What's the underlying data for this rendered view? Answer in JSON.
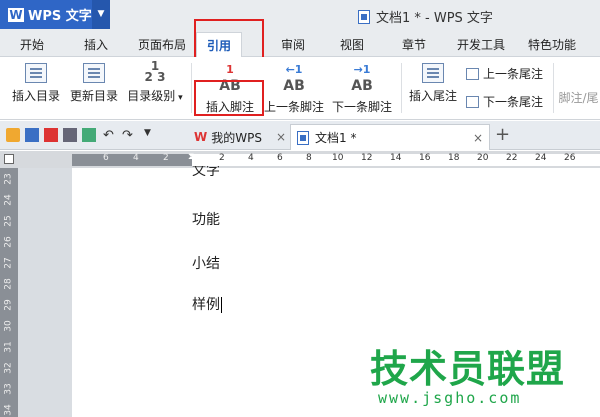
{
  "app": {
    "menu_label": "WPS 文字",
    "doc_title": "文档1 * - WPS 文字"
  },
  "tabs": [
    "开始",
    "插入",
    "页面布局",
    "引用",
    "审阅",
    "视图",
    "章节",
    "开发工具",
    "特色功能"
  ],
  "active_tab": "引用",
  "ribbon": {
    "insert_toc": "插入目录",
    "update_toc": "更新目录",
    "toc_level": "目录级别",
    "insert_footnote": "插入脚注",
    "prev_footnote": "上一条脚注",
    "next_footnote": "下一条脚注",
    "insert_endnote": "插入尾注",
    "prev_endnote": "上一条尾注",
    "next_endnote": "下一条尾注",
    "footnote_endnote_cut": "脚注/尾"
  },
  "doc_tabs": {
    "mywps": "我的WPS",
    "doc1": "文档1 *",
    "close": "×",
    "add": "+"
  },
  "ruler": {
    "top_labels_left": [
      "6",
      "4",
      "2"
    ],
    "top_labels_right": [
      "2",
      "4",
      "6",
      "8",
      "10",
      "12",
      "14",
      "16",
      "18",
      "20",
      "22",
      "24",
      "26"
    ],
    "left_labels": [
      "23",
      "24",
      "25",
      "26",
      "27",
      "28",
      "29",
      "30",
      "31",
      "32",
      "33",
      "34"
    ]
  },
  "document": {
    "lines": [
      "文字",
      "功能",
      "小结",
      "样例"
    ]
  },
  "watermark": {
    "title": "技术员联盟",
    "url": "www.jsgho.com"
  },
  "colors": {
    "accent": "#2f66c6",
    "highlight": "#e02020",
    "watermark": "#1fa64a"
  }
}
